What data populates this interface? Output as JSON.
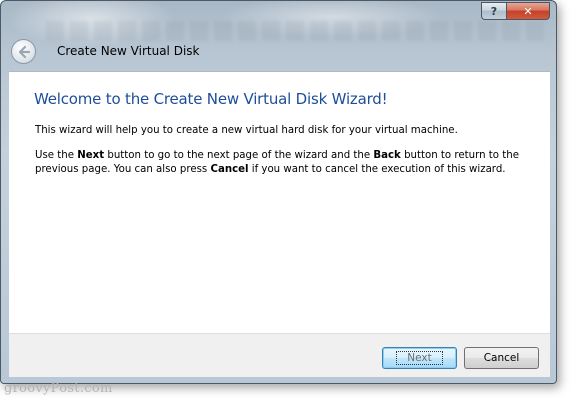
{
  "window": {
    "title": "Create New Virtual Disk",
    "caption_buttons": {
      "help": "?",
      "close": "✕"
    },
    "back_icon": "back-arrow-icon"
  },
  "content": {
    "heading": "Welcome to the Create New Virtual Disk Wizard!",
    "paragraph1": "This wizard will help you to create a new virtual hard disk for your virtual machine.",
    "paragraph2": {
      "t1": "Use the ",
      "b1": "Next",
      "t2": " button to go to the next page of the wizard and the ",
      "b2": "Back",
      "t3": " button to return to the previous page. You can also press ",
      "b3": "Cancel",
      "t4": " if you want to cancel the execution of this wizard."
    }
  },
  "footer": {
    "next_label": "Next",
    "cancel_label": "Cancel"
  },
  "watermark": "groovyPost.com",
  "colors": {
    "heading": "#1e4e9a",
    "close_button": "#c4412a",
    "frame": "#b9c8d6"
  }
}
